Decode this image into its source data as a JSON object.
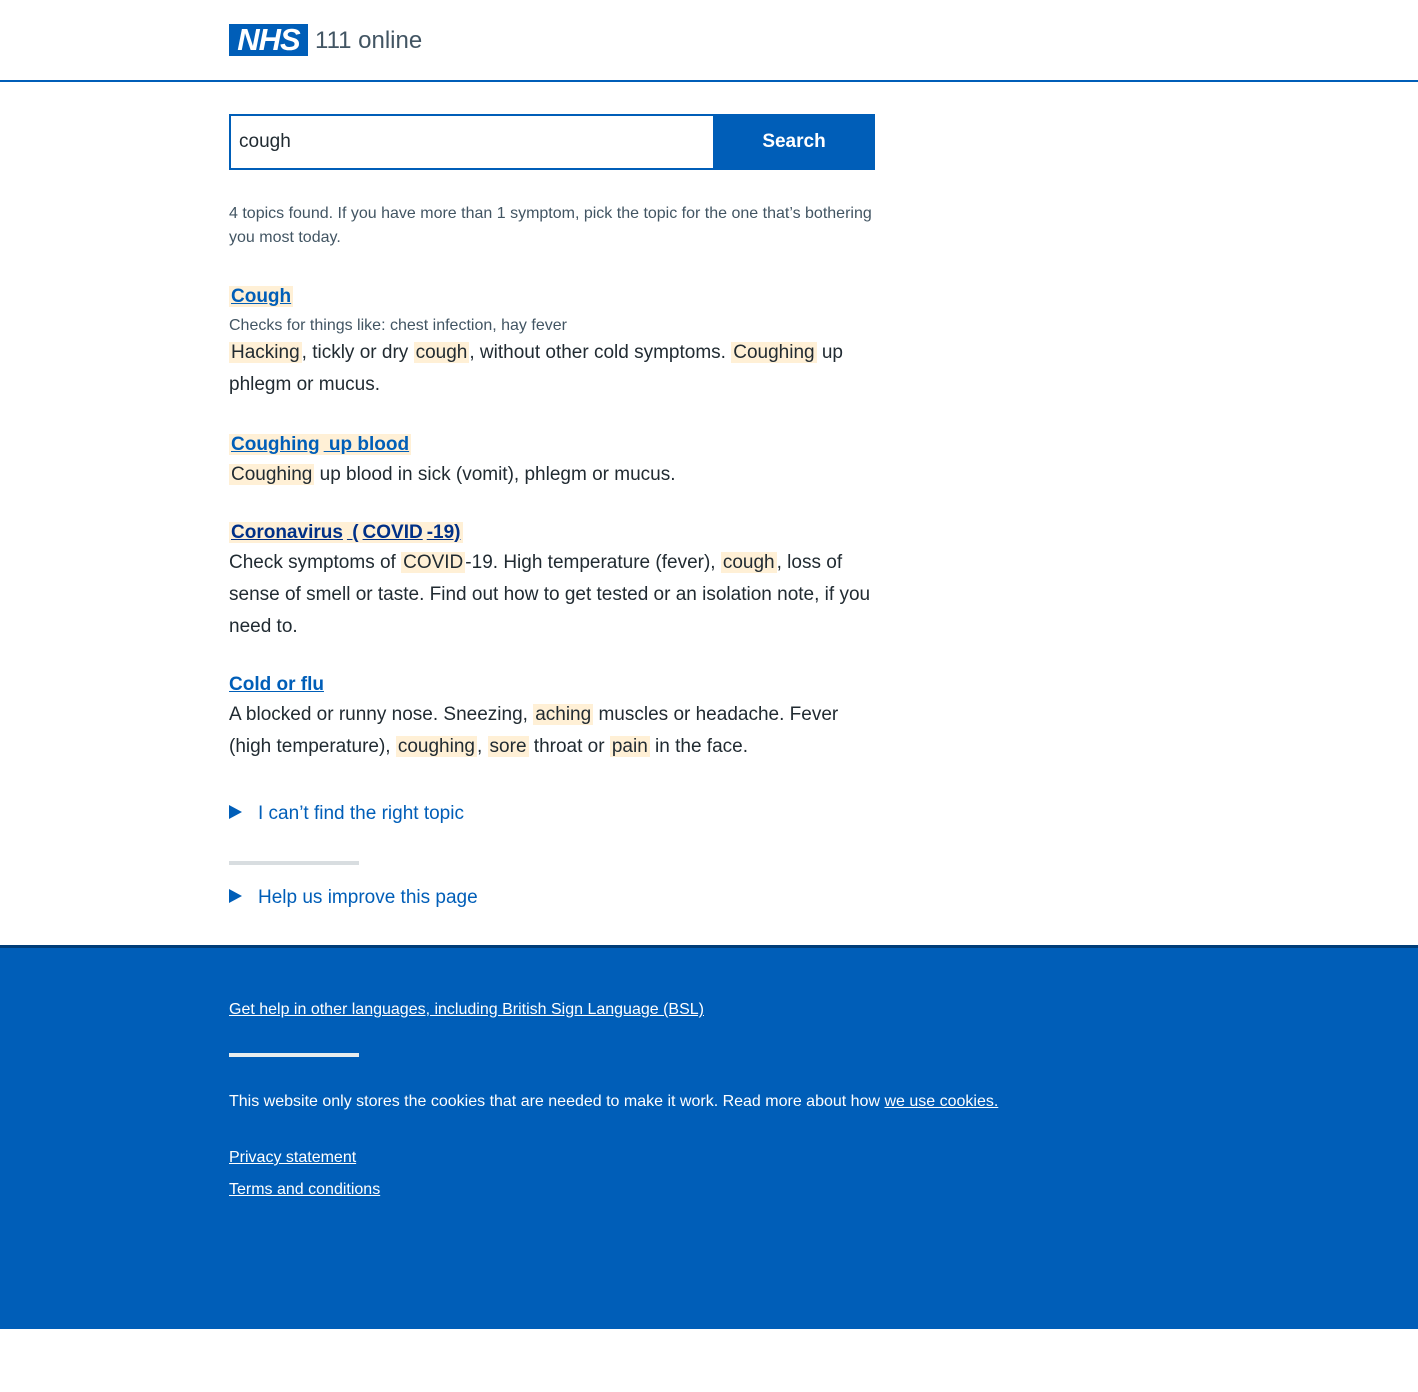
{
  "header": {
    "logo_text": "NHS",
    "service_name": "111 online"
  },
  "search": {
    "value": "cough",
    "button_label": "Search"
  },
  "results_count": "4 topics found. If you have more than 1 symptom, pick the topic for the one that’s bothering you most today.",
  "results": [
    {
      "title_parts": [
        {
          "text": "Cough",
          "hl": true
        }
      ],
      "subtitle": "Checks for things like: chest infection, hay fever",
      "desc_parts": [
        {
          "text": "Hacking",
          "hl": true
        },
        {
          "text": ", tickly or dry ",
          "hl": false
        },
        {
          "text": "cough",
          "hl": true
        },
        {
          "text": ", without other cold symptoms. ",
          "hl": false
        },
        {
          "text": "Coughing",
          "hl": true
        },
        {
          "text": " up phlegm or mucus.",
          "hl": false
        }
      ]
    },
    {
      "title_parts": [
        {
          "text": "Coughing",
          "hl": true
        },
        {
          "text": " up blood",
          "hl": true
        }
      ],
      "subtitle": "",
      "desc_parts": [
        {
          "text": "Coughing",
          "hl": true
        },
        {
          "text": " up blood in sick (vomit), phlegm or mucus.",
          "hl": false
        }
      ]
    },
    {
      "title_parts": [
        {
          "text": "Coronavirus",
          "hl": true
        },
        {
          "text": " (",
          "hl": true
        },
        {
          "text": "COVID",
          "hl": true
        },
        {
          "text": "-19)",
          "hl": true
        }
      ],
      "subtitle": "",
      "desc_parts": [
        {
          "text": "Check symptoms of ",
          "hl": false
        },
        {
          "text": "COVID",
          "hl": true
        },
        {
          "text": "-19. High temperature (fever), ",
          "hl": false
        },
        {
          "text": "cough",
          "hl": true
        },
        {
          "text": ", loss of sense of smell or taste. Find out how to get tested or an isolation note, if you need to.",
          "hl": false
        }
      ]
    },
    {
      "title_parts": [
        {
          "text": "Cold or flu",
          "hl": false
        }
      ],
      "subtitle": "",
      "desc_parts": [
        {
          "text": "A blocked or runny nose. Sneezing, ",
          "hl": false
        },
        {
          "text": "aching",
          "hl": true
        },
        {
          "text": " muscles or headache. Fever (high temperature), ",
          "hl": false
        },
        {
          "text": "coughing",
          "hl": true
        },
        {
          "text": ", ",
          "hl": false
        },
        {
          "text": "sore",
          "hl": true
        },
        {
          "text": " throat or ",
          "hl": false
        },
        {
          "text": "pain",
          "hl": true
        },
        {
          "text": " in the face.",
          "hl": false
        }
      ]
    }
  ],
  "details": {
    "cant_find": "I can’t find the right topic",
    "help_improve": "Help us improve this page"
  },
  "footer": {
    "languages_link": "Get help in other languages, including British Sign Language (BSL)",
    "cookies_text": "This website only stores the cookies that are needed to make it work. Read more about how ",
    "cookies_link": "we use cookies.",
    "privacy_link": "Privacy statement",
    "terms_link": "Terms and conditions"
  },
  "colors": {
    "brand_blue": "#005eb8",
    "highlight": "#fff0d6",
    "text": "#212b32",
    "secondary_text": "#425563"
  }
}
